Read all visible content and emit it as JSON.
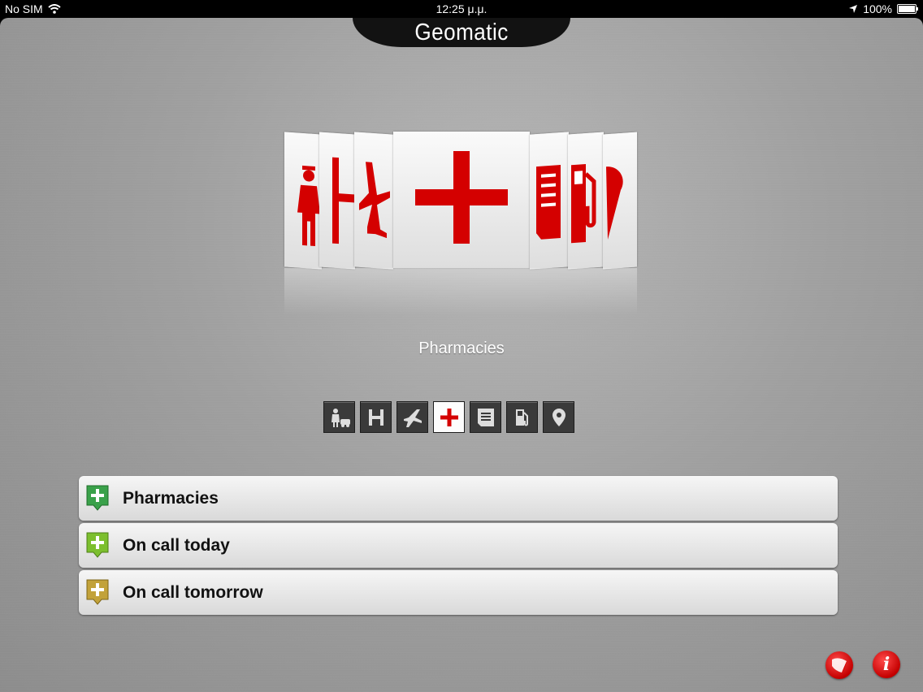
{
  "status_bar": {
    "carrier": "No SIM",
    "time": "12:25 μ.μ.",
    "battery": "100%"
  },
  "app": {
    "title": "Geomatic"
  },
  "carousel": {
    "selected_label": "Pharmacies",
    "cards": [
      "taxi-driver-icon",
      "hospital-icon",
      "airport-icon",
      "pharmacy-cross-icon",
      "newspaper-icon",
      "fuel-icon",
      "location-pin-icon"
    ],
    "accent_color": "#d40000"
  },
  "category_strip": {
    "items": [
      "taxi-icon",
      "hospital-icon",
      "airport-icon",
      "pharmacy-icon",
      "newspaper-icon",
      "fuel-icon",
      "poi-icon"
    ],
    "selected_item": "pharmacy-icon"
  },
  "list": {
    "items": [
      {
        "label": "Pharmacies",
        "pin_color": "#3aa14a"
      },
      {
        "label": "On call today",
        "pin_color": "#7cbf2e"
      },
      {
        "label": "On call tomorrow",
        "pin_color": "#c2a23a"
      }
    ]
  }
}
